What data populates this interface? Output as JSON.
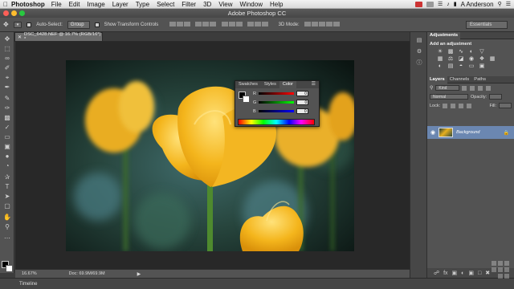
{
  "menubar": {
    "app_name": "Photoshop",
    "items": [
      "File",
      "Edit",
      "Image",
      "Layer",
      "Type",
      "Select",
      "Filter",
      "3D",
      "View",
      "Window",
      "Help"
    ],
    "user": "A Anderson"
  },
  "window": {
    "title": "Adobe Photoshop CC"
  },
  "options_bar": {
    "auto_select_label": "Auto-Select:",
    "auto_select_value": "Group",
    "transform_label": "Show Transform Controls",
    "mode_label": "3D Mode:",
    "workspace": "Essentials"
  },
  "document": {
    "tab_label": "DSC_6428.NEF @ 16.7% (RGB/16*) *"
  },
  "status": {
    "zoom": "16.67%",
    "doc_size": "Doc: 69.9M/69.9M"
  },
  "timeline": {
    "label": "Timeline"
  },
  "color_panel": {
    "tabs": [
      "Swatches",
      "Styles",
      "Color"
    ],
    "active_tab": "Color",
    "channels": [
      {
        "label": "R",
        "value": "0"
      },
      {
        "label": "G",
        "value": "0"
      },
      {
        "label": "B",
        "value": "0"
      }
    ]
  },
  "adjustments_panel": {
    "tab": "Adjustments",
    "title": "Add an adjustment"
  },
  "layers_panel": {
    "tabs": [
      "Layers",
      "Channels",
      "Paths"
    ],
    "kind_filter": "Kind",
    "blend_mode": "Normal",
    "opacity_label": "Opacity:",
    "lock_label": "Lock:",
    "fill_label": "Fill:",
    "layer_name": "Background"
  },
  "colors": {
    "layer_selected": "#6b87b1",
    "panel_bg": "#535353",
    "canvas_bg": "#282828"
  }
}
